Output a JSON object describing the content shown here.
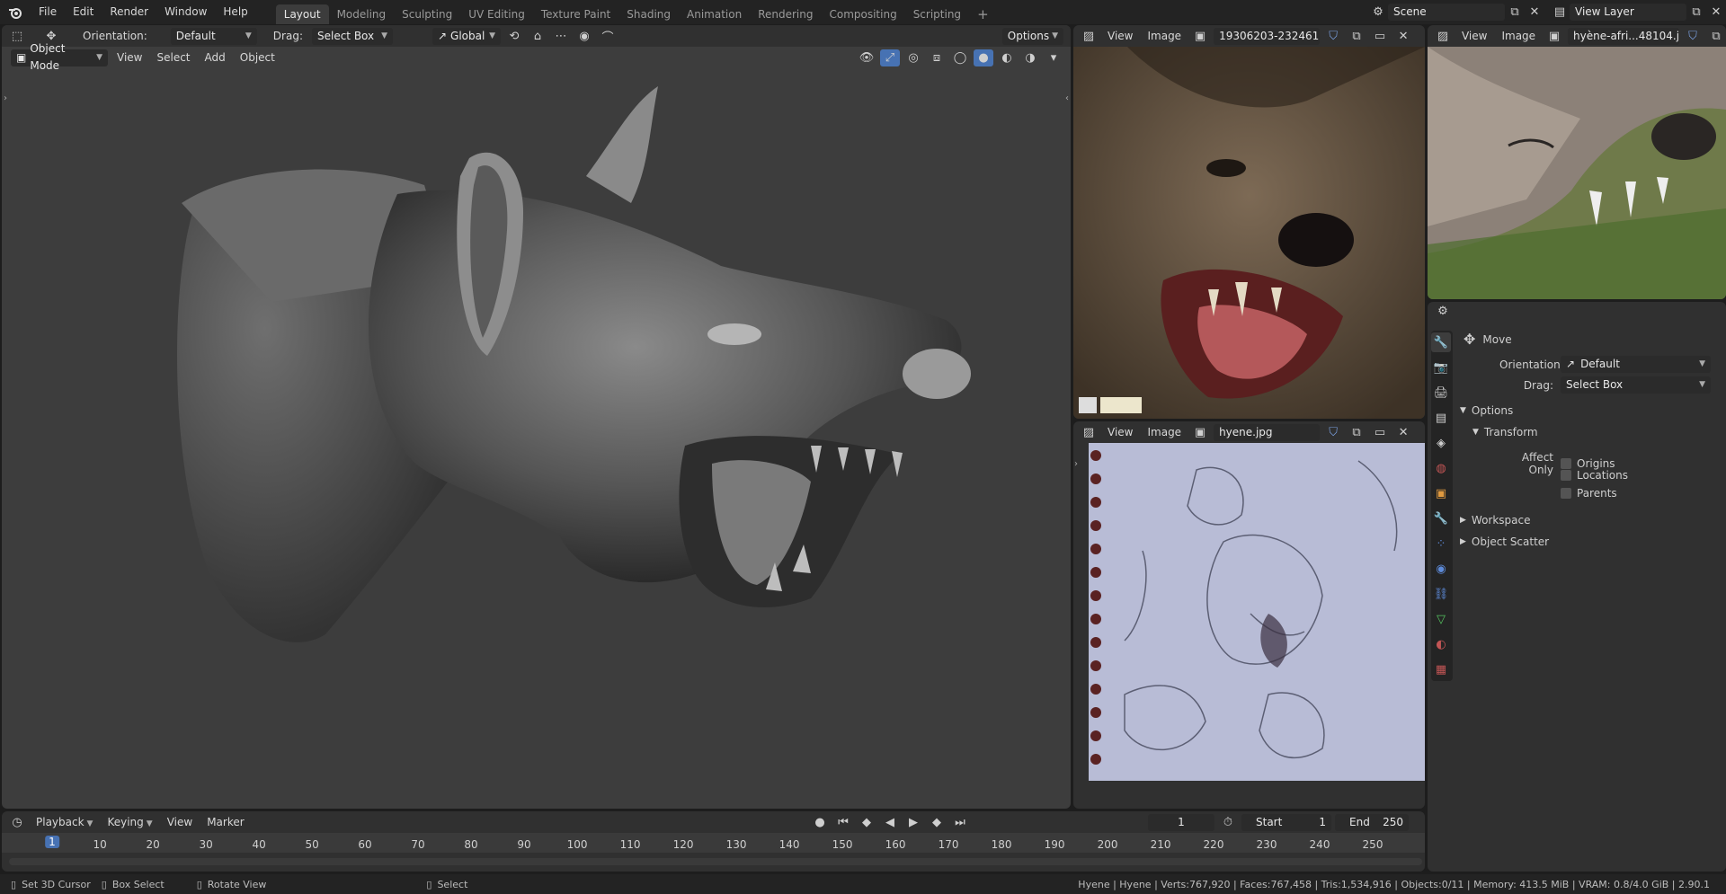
{
  "menu": {
    "items": [
      "File",
      "Edit",
      "Render",
      "Window",
      "Help"
    ]
  },
  "workspaces": [
    "Layout",
    "Modeling",
    "Sculpting",
    "UV Editing",
    "Texture Paint",
    "Shading",
    "Animation",
    "Rendering",
    "Compositing",
    "Scripting"
  ],
  "add_tab": "+",
  "scene": {
    "name": "Scene",
    "view_layer": "View Layer"
  },
  "toolbar": {
    "orientation_label": "Orientation:",
    "orientation_value": "Default",
    "drag_label": "Drag:",
    "drag_value": "Select Box",
    "transform_orientation": "Global",
    "options": "Options"
  },
  "viewport": {
    "mode": "Object Mode",
    "menus": [
      "View",
      "Select",
      "Add",
      "Object"
    ]
  },
  "image_editor_1": {
    "view": "View",
    "image": "Image",
    "filename": "19306203-232461..."
  },
  "image_editor_2": {
    "view": "View",
    "image": "Image",
    "filename": "hyène-afri...48104.jpg"
  },
  "image_editor_3": {
    "view": "View",
    "image": "Image",
    "filename": "hyene.jpg"
  },
  "properties": {
    "tool_name": "Move",
    "orientation_label": "Orientation",
    "orientation_value": "Default",
    "drag_label": "Drag:",
    "drag_value": "Select Box",
    "options_section": "Options",
    "transform_section": "Transform",
    "affect_only": "Affect Only",
    "affect_items": [
      "Origins",
      "Locations",
      "Parents"
    ],
    "workspace_section": "Workspace",
    "object_scatter_section": "Object Scatter"
  },
  "timeline": {
    "menus": [
      "Playback",
      "Keying",
      "View",
      "Marker"
    ],
    "current_frame": "1",
    "start_label": "Start",
    "start_value": "1",
    "end_label": "End",
    "end_value": "250",
    "ruler": [
      "1",
      "10",
      "20",
      "30",
      "40",
      "50",
      "60",
      "70",
      "80",
      "90",
      "100",
      "110",
      "120",
      "130",
      "140",
      "150",
      "160",
      "170",
      "180",
      "190",
      "200",
      "210",
      "220",
      "230",
      "240",
      "250"
    ]
  },
  "statusbar": {
    "hint1": "Set 3D Cursor",
    "hint2": "Box Select",
    "hint3": "Rotate View",
    "hint4": "Select",
    "stats": "Hyene | Hyene | Verts:767,920 | Faces:767,458 | Tris:1,534,916 | Objects:0/11 | Memory: 413.5 MiB | VRAM: 0.8/4.0 GiB | 2.90.1"
  },
  "colors": {
    "accent": "#4772b3",
    "active_tab": "#3c3c3c",
    "viewport_bg": "#3d3d3d",
    "sketch_bg": "#b8bcd6"
  }
}
